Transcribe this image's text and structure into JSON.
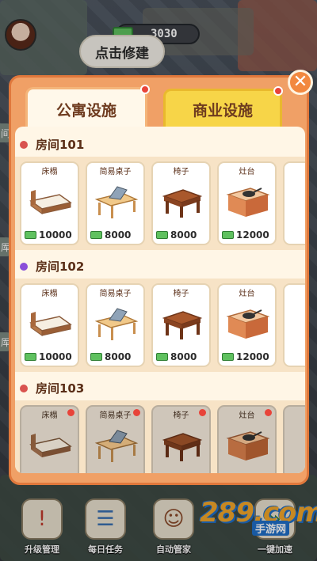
{
  "header": {
    "money": "3030",
    "repair_label": "点击修建"
  },
  "side_tags": [
    "间",
    "厍",
    "厍"
  ],
  "dialog": {
    "tabs": [
      {
        "label": "公寓设施",
        "active": true
      },
      {
        "label": "商业设施",
        "active": false
      }
    ],
    "close_symbol": "✕",
    "rooms": [
      {
        "title": "房间101",
        "dot_color": "#d9534f",
        "locked": false,
        "items": [
          {
            "name": "床榻",
            "price": "10000",
            "icon": "bed-icon"
          },
          {
            "name": "简易桌子",
            "price": "8000",
            "icon": "laptop-desk-icon"
          },
          {
            "name": "椅子",
            "price": "8000",
            "icon": "stool-icon"
          },
          {
            "name": "灶台",
            "price": "12000",
            "icon": "stove-icon"
          }
        ]
      },
      {
        "title": "房间102",
        "dot_color": "#8a4fd9",
        "locked": false,
        "items": [
          {
            "name": "床榻",
            "price": "10000",
            "icon": "bed-icon"
          },
          {
            "name": "简易桌子",
            "price": "8000",
            "icon": "laptop-desk-icon"
          },
          {
            "name": "椅子",
            "price": "8000",
            "icon": "stool-icon"
          },
          {
            "name": "灶台",
            "price": "12000",
            "icon": "stove-icon"
          }
        ]
      },
      {
        "title": "房间103",
        "dot_color": "#d9534f",
        "locked": true,
        "items": [
          {
            "name": "床榻",
            "icon": "bed-icon"
          },
          {
            "name": "简易桌子",
            "icon": "laptop-desk-icon"
          },
          {
            "name": "椅子",
            "icon": "stool-icon"
          },
          {
            "name": "灶台",
            "icon": "stove-icon"
          }
        ]
      }
    ]
  },
  "bottom_menu": [
    {
      "label": "升级管理",
      "icon": "upgrade-icon"
    },
    {
      "label": "每日任务",
      "icon": "task-icon"
    },
    {
      "label": "自动管家",
      "icon": "butler-icon"
    },
    {
      "label": "一键加速",
      "icon": "speedup-icon"
    }
  ],
  "watermark": {
    "big": "289.com",
    "small": "手游网"
  }
}
